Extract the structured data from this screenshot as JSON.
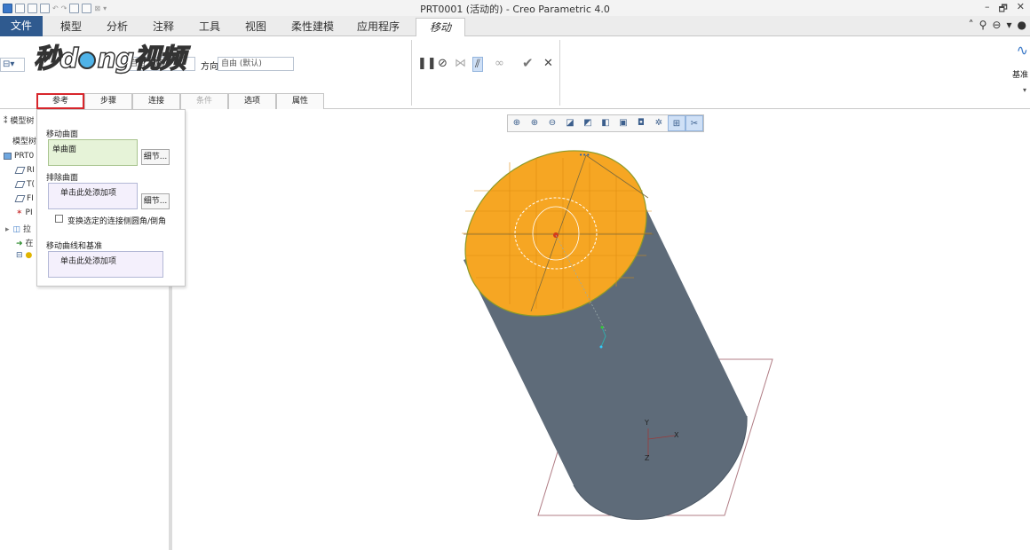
{
  "window": {
    "title": "PRT0001 (活动的) - Creo Parametric 4.0",
    "minimize": "–",
    "restore": "🗗",
    "close": "✕"
  },
  "quick_access": {
    "icons": [
      "app-icon",
      "new-icon",
      "open-icon",
      "save-icon",
      "undo-icon",
      "redo-icon",
      "regenerate-icon",
      "windows-icon",
      "close-window-icon",
      "customize-icon"
    ]
  },
  "ribbon_tabs": [
    "文件",
    "模型",
    "分析",
    "注释",
    "工具",
    "视图",
    "柔性建模",
    "应用程序",
    "移动"
  ],
  "ribbon": {
    "direction_label": "方向",
    "direction_value": "自由 (默认)",
    "first_field_value": "自由 (默认)",
    "right_group_label": "基准"
  },
  "watermark": {
    "text_before": "秒d",
    "text_after": "ng视频"
  },
  "dashboard_tabs": [
    {
      "label": "参考",
      "state": "active"
    },
    {
      "label": "步骤",
      "state": "normal"
    },
    {
      "label": "连接",
      "state": "normal"
    },
    {
      "label": "条件",
      "state": "disabled"
    },
    {
      "label": "选项",
      "state": "normal"
    },
    {
      "label": "属性",
      "state": "normal"
    }
  ],
  "reference_panel": {
    "move_surfaces_label": "移动曲面",
    "move_surfaces_value": "单曲面",
    "exclude_surfaces_label": "排除曲面",
    "exclude_surfaces_value": "单击此处添加项",
    "details_button": "细节...",
    "checkbox_label": "变换选定的连接侧圆角/倒角",
    "move_curves_label": "移动曲线和基准",
    "move_curves_value": "单击此处添加项"
  },
  "navigator": {
    "header": "模型树",
    "subheader": "模型树",
    "items": [
      "PRT0",
      "RI",
      "T(",
      "FI",
      "PI",
      "拉",
      "在",
      ""
    ]
  },
  "graphics": {
    "axis_labels": {
      "x": "X",
      "y": "Y",
      "z": "Z"
    }
  },
  "colors": {
    "file_tab": "#2f5a8f",
    "highlight_red": "#d8262c",
    "top_face": "#f6a623",
    "cylinder_body": "#5e6b79",
    "datum_plane": "#b07c84"
  }
}
